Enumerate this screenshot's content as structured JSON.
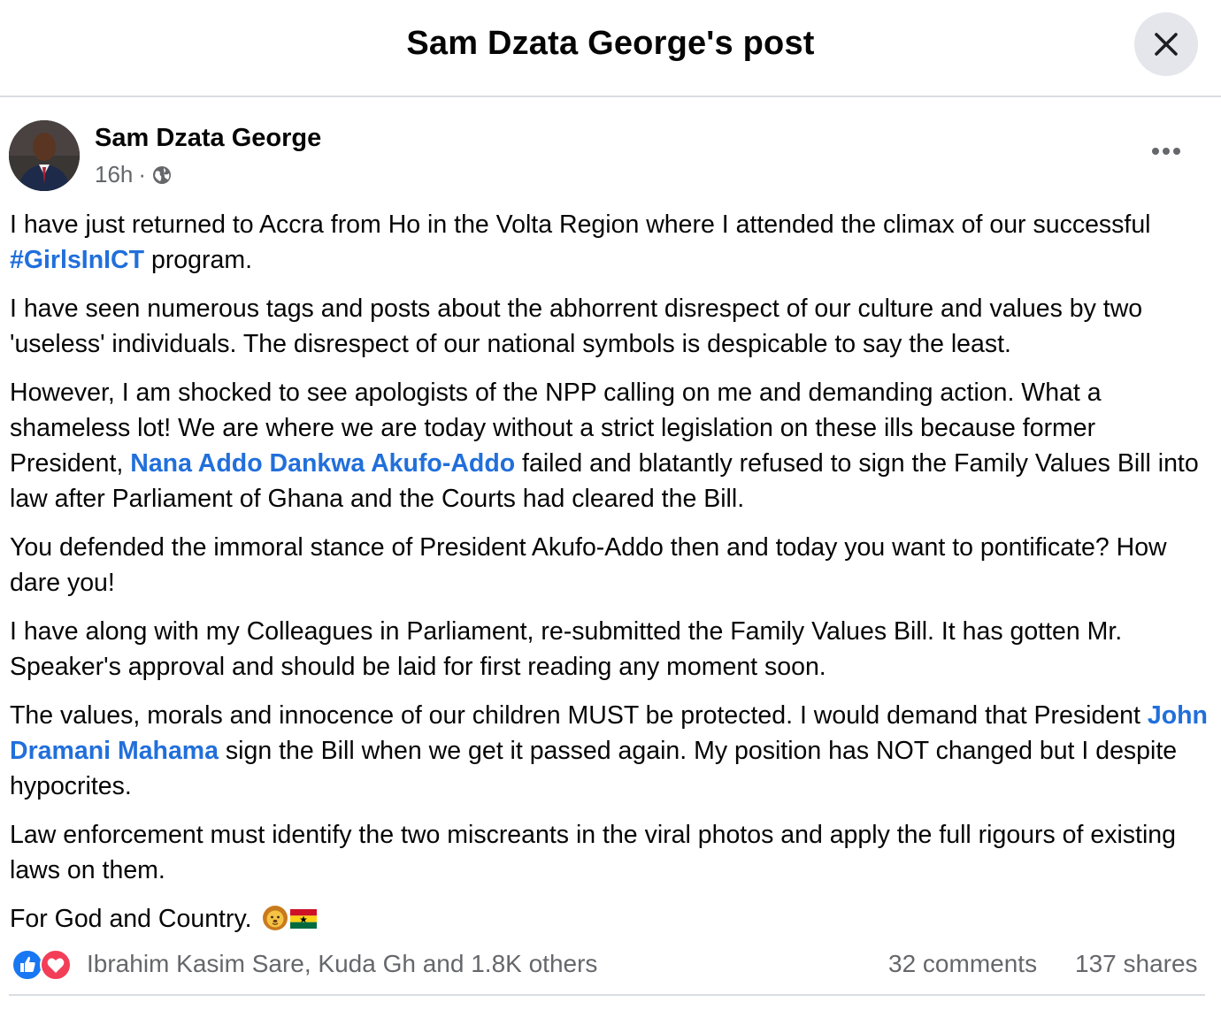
{
  "modal": {
    "title": "Sam Dzata George's post"
  },
  "post": {
    "author": "Sam Dzata George",
    "time": "16h",
    "separator": "·",
    "privacy_icon": "globe-icon",
    "paragraphs": {
      "p1": {
        "a": "I have just returned to Accra from Ho in the Volta Region where I attended the climax of our successful ",
        "hashtag": "#GirlsInICT",
        "b": " program."
      },
      "p2": "I have seen numerous tags and posts about the abhorrent disrespect of our culture and values by two 'useless' individuals. The disrespect of our national symbols is despicable to say the least.",
      "p3": {
        "a": "However, I am shocked to see apologists of the NPP calling on me and demanding action. What a shameless lot! We are where we are today without a strict legislation on these ills because former President, ",
        "mention": "Nana Addo Dankwa Akufo-Addo",
        "b": " failed and blatantly refused to sign the Family Values Bill into law after Parliament of Ghana and the Courts had cleared the Bill."
      },
      "p4": "You defended the immoral stance of President Akufo-Addo then and today you want to pontificate? How dare you!",
      "p5": "I have along with my Colleagues in Parliament, re-submitted the Family Values Bill. It has gotten Mr. Speaker's approval and should be laid for first reading any moment soon.",
      "p6": {
        "a": "The values, morals and innocence of our children MUST be protected. I would demand that President ",
        "mention": "John Dramani Mahama",
        "b": " sign the Bill when we get it passed again. My position has NOT changed but I despite hypocrites."
      },
      "p7": "Law enforcement must identify the two miscreants in the viral photos and apply the full rigours of existing laws on them.",
      "p8": "For God and Country."
    }
  },
  "footer": {
    "reaction_icons": [
      "like-icon",
      "love-icon"
    ],
    "reaction_names": "Ibrahim Kasim Sare, Kuda Gh and 1.8K others",
    "comments": "32 comments",
    "shares": "137 shares"
  },
  "colors": {
    "link": "#216fdb",
    "secondary_text": "#65676b",
    "divider": "#dadde1",
    "like_blue": "#1877f2",
    "love_red": "#f33e58"
  }
}
